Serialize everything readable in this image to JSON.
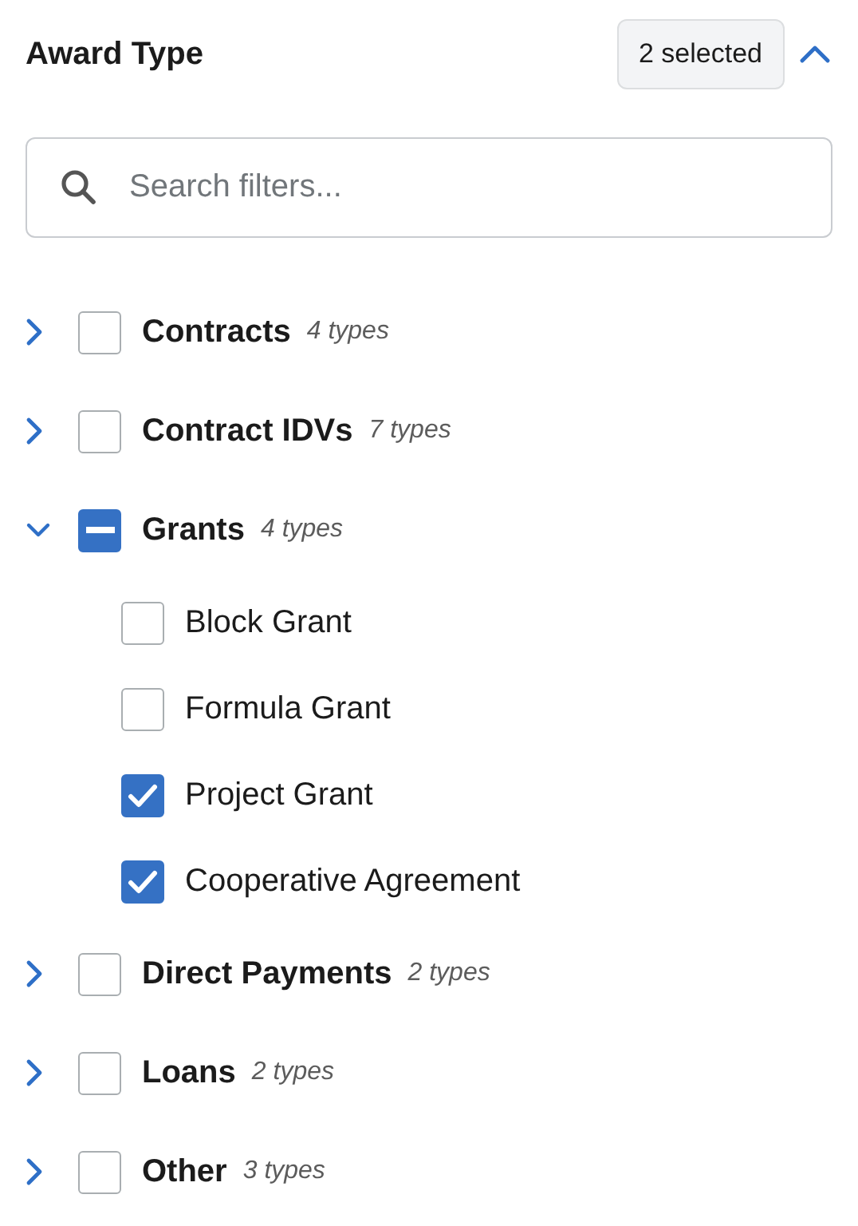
{
  "filter": {
    "title": "Award Type",
    "badge": "2 selected",
    "expanded": true
  },
  "search": {
    "placeholder": "Search filters..."
  },
  "items": [
    {
      "label": "Contracts",
      "count": "4 types",
      "expanded": false,
      "checked": false,
      "indeterminate": false
    },
    {
      "label": "Contract IDVs",
      "count": "7 types",
      "expanded": false,
      "checked": false,
      "indeterminate": false
    },
    {
      "label": "Grants",
      "count": "4 types",
      "expanded": true,
      "checked": false,
      "indeterminate": true,
      "children": [
        {
          "label": "Block Grant",
          "checked": false
        },
        {
          "label": "Formula Grant",
          "checked": false
        },
        {
          "label": "Project Grant",
          "checked": true
        },
        {
          "label": "Cooperative Agreement",
          "checked": true
        }
      ]
    },
    {
      "label": "Direct Payments",
      "count": "2 types",
      "expanded": false,
      "checked": false,
      "indeterminate": false
    },
    {
      "label": "Loans",
      "count": "2 types",
      "expanded": false,
      "checked": false,
      "indeterminate": false
    },
    {
      "label": "Other",
      "count": "3 types",
      "expanded": false,
      "checked": false,
      "indeterminate": false
    }
  ]
}
